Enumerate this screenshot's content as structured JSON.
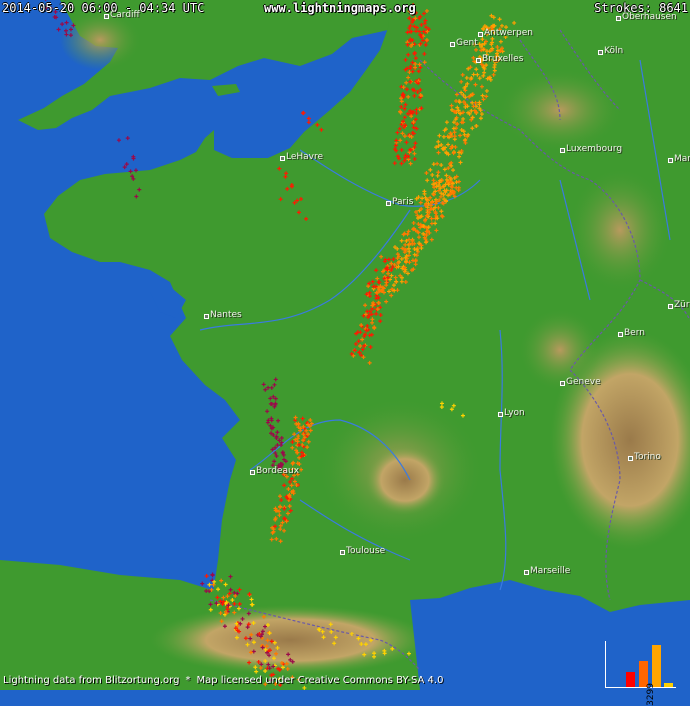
{
  "header": {
    "date_range": "2014-05-20 06:00 - 04:34 UTC",
    "site": "www.lightningmaps.org",
    "strokes": "Strokes: 8641"
  },
  "footer": {
    "credit": "Lightning data from Blitzortung.org",
    "separator": "*",
    "license": "Map licensed under Creative Commons BY-SA 4.0"
  },
  "cities": [
    {
      "name": "Gent"
    },
    {
      "name": "Antwerpen"
    },
    {
      "name": "Bruxelles"
    },
    {
      "name": "Köln"
    },
    {
      "name": "Luxembourg"
    },
    {
      "name": "LeHavre"
    },
    {
      "name": "Paris"
    },
    {
      "name": "Nantes"
    },
    {
      "name": "Bern"
    },
    {
      "name": "Geneve"
    },
    {
      "name": "Lyon"
    },
    {
      "name": "Torino"
    },
    {
      "name": "Bordeaux"
    },
    {
      "name": "Toulouse"
    },
    {
      "name": "Marseille"
    },
    {
      "name": "Cardiff"
    },
    {
      "name": "Oberhausen"
    },
    {
      "name": "Mannheim"
    },
    {
      "name": "Zürich"
    }
  ],
  "legend": {
    "value_label": "3299",
    "bars": [
      {
        "color": "#ff0000",
        "level": 0.35
      },
      {
        "color": "#ff6600",
        "level": 0.6
      },
      {
        "color": "#ffa500",
        "level": 0.95
      },
      {
        "color": "#ffd000",
        "level": 0.1
      }
    ]
  },
  "colors": {
    "sea": "#1f63c9",
    "land": "#3f9a2f",
    "highland": "#b49a5a",
    "mountain": "#8c6f48",
    "river": "#3a7be0",
    "border": "#6a5aa8",
    "strike_old": "#9a0a4a",
    "strike_red": "#ff1a00",
    "strike_orange": "#ff7a00",
    "strike_amber": "#ffa000",
    "strike_yellow": "#ffd200"
  }
}
